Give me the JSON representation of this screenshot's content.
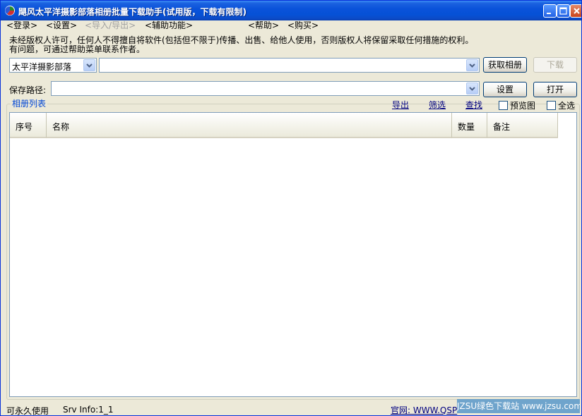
{
  "window": {
    "title": "飓风太平洋摄影部落相册批量下载助手(试用版，下载有限制)"
  },
  "menu": [
    {
      "label": "<登录>",
      "enabled": true
    },
    {
      "label": "<设置>",
      "enabled": true
    },
    {
      "label": "<导入/导出>",
      "enabled": false
    },
    {
      "label": "<辅助功能>",
      "enabled": true
    },
    {
      "label": "<帮助>",
      "enabled": true
    },
    {
      "label": "<购买>",
      "enabled": true
    }
  ],
  "notice": {
    "line1": "未经版权人许可，任何人不得擅自将软件(包括但不限于)传播、出售、给他人使用，否则版权人将保留采取任何措施的权利。",
    "line2": "有问题，可通过帮助菜单联系作者。"
  },
  "source": {
    "selected": "太平洋摄影部落",
    "url_value": "",
    "fetch_label": "获取相册",
    "download_label": "下载"
  },
  "save": {
    "label": "保存路径:",
    "path_value": "",
    "set_label": "设置",
    "open_label": "打开"
  },
  "album_list": {
    "title": "相册列表",
    "export_link": "导出",
    "filter_link": "筛选",
    "find_link": "查找",
    "preview_label": "预览图",
    "select_all_label": "全选",
    "columns": [
      "序号",
      "名称",
      "数量",
      "备注"
    ],
    "rows": []
  },
  "status": {
    "license": "可永久使用",
    "srv_info": "Srv Info:1_1",
    "website": "官网: WWW.QSP",
    "watermark": "JZSU绿色下载站 www.jzsu.com"
  },
  "colors": {
    "title_bar": "#0a52da",
    "window_bg": "#ece9d8",
    "link": "#000080",
    "group_title": "#0046d5"
  }
}
